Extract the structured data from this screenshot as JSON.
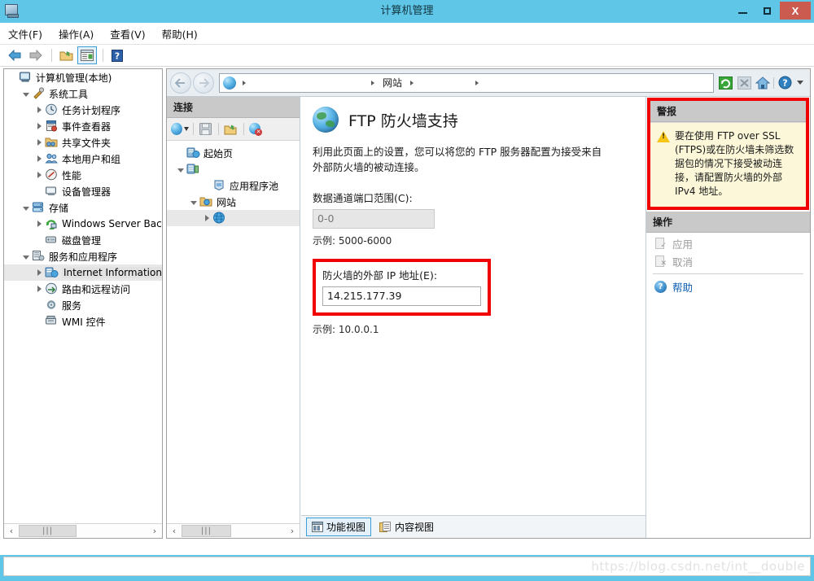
{
  "window": {
    "title": "计算机管理",
    "sysicon": "computer-icon",
    "buttons": {
      "minimize": "−",
      "maximize": "□",
      "close": "X"
    }
  },
  "menubar": {
    "items": [
      {
        "label": "文件(F)",
        "name": "menu-file"
      },
      {
        "label": "操作(A)",
        "name": "menu-action"
      },
      {
        "label": "查看(V)",
        "name": "menu-view"
      },
      {
        "label": "帮助(H)",
        "name": "menu-help"
      }
    ]
  },
  "toolbar": {
    "buttons": [
      {
        "name": "back-button",
        "icon": "back-arrow-icon"
      },
      {
        "name": "forward-button",
        "icon": "forward-arrow-icon"
      },
      {
        "name": "show-hide-console-tree-button",
        "icon": "folder-open-icon"
      },
      {
        "name": "show-hide-action-pane-button",
        "icon": "window-panes-icon"
      },
      {
        "name": "help-button",
        "icon": "question-mark-icon"
      }
    ]
  },
  "mmc_tree": {
    "items": [
      {
        "label": "计算机管理(本地)",
        "indent": 0,
        "twist": "none",
        "icon": "computer-icon",
        "name": "tree-computer-management-local"
      },
      {
        "label": "系统工具",
        "indent": 1,
        "twist": "open",
        "icon": "tools-icon",
        "name": "tree-system-tools"
      },
      {
        "label": "任务计划程序",
        "indent": 2,
        "twist": "closed",
        "icon": "clock-icon",
        "name": "tree-task-scheduler"
      },
      {
        "label": "事件查看器",
        "indent": 2,
        "twist": "closed",
        "icon": "event-viewer-icon",
        "name": "tree-event-viewer"
      },
      {
        "label": "共享文件夹",
        "indent": 2,
        "twist": "closed",
        "icon": "shared-folder-icon",
        "name": "tree-shared-folders"
      },
      {
        "label": "本地用户和组",
        "indent": 2,
        "twist": "closed",
        "icon": "users-icon",
        "name": "tree-local-users-groups"
      },
      {
        "label": "性能",
        "indent": 2,
        "twist": "closed",
        "icon": "performance-icon",
        "name": "tree-performance"
      },
      {
        "label": "设备管理器",
        "indent": 2,
        "twist": "none",
        "icon": "device-manager-icon",
        "name": "tree-device-manager"
      },
      {
        "label": "存储",
        "indent": 1,
        "twist": "open",
        "icon": "storage-icon",
        "name": "tree-storage"
      },
      {
        "label": "Windows Server Back",
        "indent": 2,
        "twist": "closed",
        "icon": "backup-icon",
        "name": "tree-windows-server-backup"
      },
      {
        "label": "磁盘管理",
        "indent": 2,
        "twist": "none",
        "icon": "disk-management-icon",
        "name": "tree-disk-management"
      },
      {
        "label": "服务和应用程序",
        "indent": 1,
        "twist": "open",
        "icon": "services-apps-icon",
        "name": "tree-services-and-applications"
      },
      {
        "label": "Internet Information S",
        "indent": 2,
        "twist": "closed",
        "icon": "iis-icon",
        "name": "tree-internet-information-services",
        "selected": true
      },
      {
        "label": "路由和远程访问",
        "indent": 2,
        "twist": "closed",
        "icon": "routing-icon",
        "name": "tree-routing-remote-access"
      },
      {
        "label": "服务",
        "indent": 2,
        "twist": "none",
        "icon": "gear-icon",
        "name": "tree-services"
      },
      {
        "label": "WMI 控件",
        "indent": 2,
        "twist": "none",
        "icon": "wmi-icon",
        "name": "tree-wmi-control"
      }
    ]
  },
  "iis": {
    "address": {
      "back_icon": "back-circle-icon",
      "forward_icon": "forward-circle-icon",
      "crumbs": [
        {
          "label": "",
          "icon": "globe-icon",
          "name": "breadcrumb-server"
        },
        {
          "label": "网站",
          "icon": "",
          "name": "breadcrumb-sites"
        },
        {
          "label": "",
          "icon": "",
          "name": "breadcrumb-site"
        }
      ],
      "tools": [
        {
          "name": "refresh-button",
          "icon": "refresh-icon"
        },
        {
          "name": "stop-button",
          "icon": "stop-x-icon"
        },
        {
          "name": "home-button",
          "icon": "home-icon"
        },
        {
          "name": "help-dropdown-button",
          "icon": "help-circle-icon"
        }
      ]
    },
    "connections": {
      "header": "连接",
      "toolbar": [
        {
          "name": "add-connection-button",
          "icon": "globe-dropdown-icon"
        },
        {
          "name": "save-connection-button",
          "icon": "save-disk-icon"
        },
        {
          "name": "open-connection-button",
          "icon": "folder-open-icon"
        },
        {
          "name": "delete-connection-button",
          "icon": "globe-delete-icon"
        }
      ],
      "tree": [
        {
          "label": "起始页",
          "indent": 0,
          "twist": "none",
          "icon": "start-page-icon",
          "name": "conn-start-page"
        },
        {
          "label": "",
          "indent": 0,
          "twist": "open",
          "icon": "server-icon",
          "name": "conn-server"
        },
        {
          "label": "应用程序池",
          "indent": 2,
          "twist": "none",
          "icon": "app-pools-icon",
          "name": "conn-application-pools"
        },
        {
          "label": "网站",
          "indent": 1,
          "twist": "open",
          "icon": "sites-folder-icon",
          "name": "conn-sites"
        },
        {
          "label": "",
          "indent": 2,
          "twist": "closed",
          "icon": "globe-icon",
          "name": "conn-site-item",
          "selected": true
        }
      ]
    },
    "page": {
      "icon": "globe-icon",
      "title": "FTP 防火墙支持",
      "description": "利用此页面上的设置，您可以将您的 FTP 服务器配置为接受来自外部防火墙的被动连接。",
      "port_range_label": "数据通道端口范围(C):",
      "port_range_value": "0-0",
      "port_range_hint": "示例: 5000-6000",
      "ip_label": "防火墙的外部 IP 地址(E):",
      "ip_value": "14.215.177.39",
      "ip_hint": "示例: 10.0.0.1"
    },
    "view_tabs": [
      {
        "label": "功能视图",
        "icon": "features-view-icon",
        "active": true,
        "name": "tab-features-view"
      },
      {
        "label": "内容视图",
        "icon": "content-view-icon",
        "active": false,
        "name": "tab-content-view"
      }
    ],
    "alerts": {
      "header": "警报",
      "icon": "warning-triangle-icon",
      "text": "要在使用 FTP over SSL (FTPS)或在防火墙未筛选数据包的情况下接受被动连接，请配置防火墙的外部 IPv4 地址。"
    },
    "actions": {
      "header": "操作",
      "items": [
        {
          "label": "应用",
          "icon": "apply-doc-icon",
          "disabled": true,
          "name": "action-apply"
        },
        {
          "label": "取消",
          "icon": "cancel-doc-icon",
          "disabled": true,
          "name": "action-cancel"
        },
        {
          "label": "帮助",
          "icon": "help-circle-icon",
          "disabled": false,
          "link": true,
          "name": "action-help"
        }
      ]
    }
  },
  "scrollbars": {
    "left_arrow": "‹",
    "right_arrow": "›",
    "grip": "|||"
  },
  "statusbar": {
    "watermark": "https://blog.csdn.net/int__double"
  },
  "colors": {
    "title_bar": "#5fc6e8",
    "close_button": "#cb5a4f",
    "highlight_red": "#f00000",
    "alert_bg": "#fbf7d8",
    "pane_header": "#c9c9c9",
    "link": "#0a5eb5"
  }
}
